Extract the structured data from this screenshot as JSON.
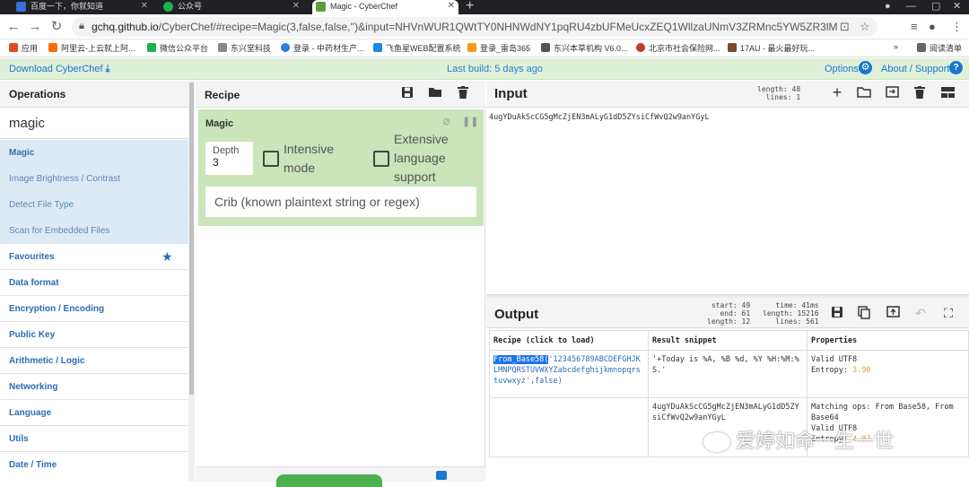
{
  "browser": {
    "tabs": [
      {
        "title": "百度一下，你就知道",
        "active": false
      },
      {
        "title": "公众号",
        "active": false
      },
      {
        "title": "Magic - CyberChef",
        "active": true
      }
    ],
    "url_host": "gchq.github.io",
    "url_rest": "/CyberChef/#recipe=Magic(3,false,false,'')&input=NHVnWUR1QWtTY0NHNWdNY1pqRU4zbUFMeUcxZEQ1WllzaUNmV3ZRMnc5YW5ZR3lM",
    "bookmarks": [
      "应用",
      "阿里云-上云就上阿...",
      "微信公众平台",
      "东兴堂科技",
      "登录 - 中药材生产...",
      "飞鱼星WEB配置系统",
      "登录_雷岛365",
      "东兴本草机构 V6.0...",
      "北京市社会保险网...",
      "17AU - 最火最好玩..."
    ],
    "reading_list": "阅读清单",
    "more": "»"
  },
  "banner": {
    "download": "Download CyberChef",
    "last_build": "Last build: 5 days ago",
    "options": "Options",
    "about": "About / Support"
  },
  "operations": {
    "title": "Operations",
    "search_value": "magic",
    "results": [
      "Magic",
      "Image Brightness / Contrast",
      "Detect File Type",
      "Scan for Embedded Files"
    ],
    "categories": [
      "Favourites",
      "Data format",
      "Encryption / Encoding",
      "Public Key",
      "Arithmetic / Logic",
      "Networking",
      "Language",
      "Utils",
      "Date / Time"
    ]
  },
  "recipe": {
    "title": "Recipe",
    "op_name": "Magic",
    "depth_label": "Depth",
    "depth_value": "3",
    "intensive_label": "Intensive mode",
    "extensive_label": "Extensive language support",
    "crib_placeholder": "Crib (known plaintext string or regex)"
  },
  "input": {
    "title": "Input",
    "length_label": "length:",
    "length": "48",
    "lines_label": "lines:",
    "lines": "1",
    "text": "4ugYDuAkScCG5gMcZjEN3mALyG1dD5ZYsiCfWvQ2w9anYGyL"
  },
  "output": {
    "title": "Output",
    "start": "49",
    "end": "61",
    "length": "12",
    "time": "41ms",
    "out_length": "15216",
    "out_lines": "561",
    "headers": [
      "Recipe (click to load)",
      "Result snippet",
      "Properties"
    ],
    "rows": [
      {
        "recipe_op": "From_Base58(",
        "recipe_args": "'123456789ABCDEFGHJKLMNPQRSTUVWXYZabcdefghijkmnopqrstuvwxyz',false)",
        "snippet": "'+Today is %A, %B %d, %Y %H:%M:%S.'",
        "prop_line1": "Valid UTF8",
        "prop_entropy_label": "Entropy: ",
        "prop_entropy": "3.90"
      },
      {
        "recipe_op": "",
        "recipe_args": "",
        "snippet": "4ugYDuAkScCG5gMcZjEN3mALyG1dD5ZYsiCfWvQ2w9anYGyL",
        "prop_line1": "Matching ops: From Base58, From Base64",
        "prop_line2": "Valid UTF8",
        "prop_entropy_label": "Entropy: ",
        "prop_entropy": "4.97"
      }
    ]
  },
  "watermark": "爱婷如命一生一世",
  "colors": {
    "banner_bg": "#dff0d8",
    "magic_card": "#c9e5b9",
    "link_blue": "#2a6db5",
    "entropy": "#e0a030"
  }
}
